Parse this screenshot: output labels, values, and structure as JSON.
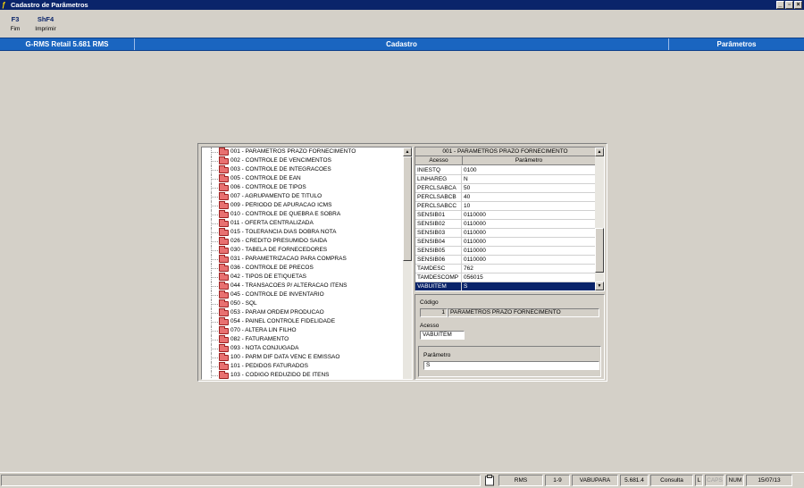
{
  "window": {
    "title": "Cadastro de Parâmetros"
  },
  "toolbar": [
    {
      "key": "F3",
      "label": "Fim"
    },
    {
      "key": "ShF4",
      "label": "Imprimir"
    }
  ],
  "header": {
    "app": "G-RMS Retail 5.681 RMS",
    "section": "Cadastro",
    "page": "Parâmetros"
  },
  "tree": {
    "items": [
      "001 - PARAMETROS PRAZO FORNECIMENTO",
      "002 - CONTROLE DE VENCIMENTOS",
      "003 - CONTROLE DE INTEGRACOES",
      "005 - CONTROLE DE EAN",
      "006 - CONTROLE DE TIPOS",
      "007 - AGRUPAMENTO DE TITULO",
      "009 - PERIODO DE APURACAO ICMS",
      "010 - CONTROLE DE QUEBRA E SOBRA",
      "011 - OFERTA CENTRALIZADA",
      "015 - TOLERANCIA DIAS DOBRA NOTA",
      "026 - CREDITO PRESUMIDO SAIDA",
      "030 - TABELA DE FORNECEDORES",
      "031 - PARAMETRIZACAO PARA COMPRAS",
      "036 - CONTROLE DE PRECOS",
      "042 - TIPOS DE ETIQUETAS",
      "044 - TRANSACOES P/ ALTERACAO ITENS",
      "045 - CONTROLE DE INVENTARIO",
      "050 - SQL",
      "053 - PARAM ORDEM PRODUCAO",
      "054 - PAINEL CONTROLE FIDELIDADE",
      "070 - ALTERA LIN FILHO",
      "082 - FATURAMENTO",
      "093 - NOTA CONJUGADA",
      "100 - PARM DIF DATA VENC E EMISSAO",
      "101 - PEDIDOS FATURADOS",
      "103 - CODIGO REDUZIDO DE ITENS"
    ]
  },
  "grid": {
    "title": "001 - PARAMETROS PRAZO FORNECIMENTO",
    "columns": [
      "Acesso",
      "Parâmetro"
    ],
    "rows": [
      [
        "INIESTQ",
        "0100"
      ],
      [
        "LINHAREG",
        "N"
      ],
      [
        "PERCLSABCA",
        "50"
      ],
      [
        "PERCLSABCB",
        "40"
      ],
      [
        "PERCLSABCC",
        "10"
      ],
      [
        "SENSIB01",
        "0110000"
      ],
      [
        "SENSIB02",
        "0110000"
      ],
      [
        "SENSIB03",
        "0110000"
      ],
      [
        "SENSIB04",
        "0110000"
      ],
      [
        "SENSIB05",
        "0110000"
      ],
      [
        "SENSIB06",
        "0110000"
      ],
      [
        "TAMDESC",
        "762"
      ],
      [
        "TAMDESCOMP",
        "056015"
      ],
      [
        "VABUITEM",
        "S"
      ]
    ],
    "selected_row": 13
  },
  "form": {
    "codigo_label": "Código",
    "codigo_value": "1",
    "codigo_desc": "PARAMETROS PRAZO FORNECIMENTO",
    "acesso_label": "Acesso",
    "acesso_value": "VABUITEM",
    "parametro_label": "Parâmetro",
    "parametro_value": "S"
  },
  "statusbar": {
    "system": "RMS",
    "page": "1-9",
    "user": "VABUPARA",
    "version": "5.681.4",
    "mode": "Consulta",
    "flag_l": "L",
    "caps": "CAPS",
    "num": "NUM",
    "date": "15/07/13"
  }
}
